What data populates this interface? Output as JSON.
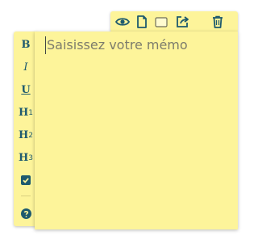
{
  "memo": {
    "placeholder": "Saisissez votre mémo"
  },
  "controls": {
    "icons": [
      "eye-icon",
      "document-icon",
      "color-swatch-icon",
      "share-icon",
      "trash-icon"
    ]
  },
  "format_toolbar": {
    "bold": "B",
    "italic": "I",
    "underline": "U",
    "h1_letter": "H",
    "h1_level": "1",
    "h2_letter": "H",
    "h2_level": "2",
    "h3_letter": "H",
    "h3_level": "3"
  },
  "colors": {
    "note_bg": "#fdf49a",
    "icon": "#1e5a6e",
    "placeholder": "#7c7c6c"
  }
}
